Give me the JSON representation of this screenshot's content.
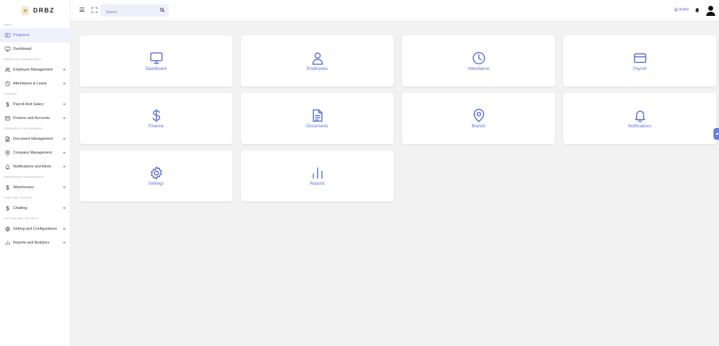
{
  "brand": {
    "name": "DRBZ"
  },
  "header": {
    "search_placeholder": "Search",
    "language": "Arabic"
  },
  "sidebar": {
    "sections": [
      {
        "title": "MAIN",
        "items": [
          {
            "label": "Programs",
            "icon": "grid-icon",
            "active": true,
            "expandable": false
          },
          {
            "label": "Dashboard",
            "icon": "monitor-icon",
            "active": false,
            "expandable": false
          }
        ]
      },
      {
        "title": "EMPLOYEE MANAGEMENT",
        "items": [
          {
            "label": "Employee Management",
            "icon": "users-icon",
            "expandable": true
          },
          {
            "label": "Attendance & Leave",
            "icon": "clock-icon",
            "expandable": true
          }
        ]
      },
      {
        "title": "FINANCE",
        "items": [
          {
            "label": "Payroll And Salary",
            "icon": "dollar-icon",
            "expandable": true
          },
          {
            "label": "Finance and Accounts",
            "icon": "card-icon",
            "expandable": true
          }
        ]
      },
      {
        "title": "DOCUMENTS AND BRANCH",
        "items": [
          {
            "label": "Document Management",
            "icon": "file-icon",
            "expandable": true
          },
          {
            "label": "Company Management",
            "icon": "pin-icon",
            "expandable": true
          },
          {
            "label": "Notifications and Alerts",
            "icon": "bell-icon",
            "expandable": true
          }
        ]
      },
      {
        "title": "WAREHOUSE MANAGEMENT",
        "items": [
          {
            "label": "Warehouses",
            "icon": "dollar-icon",
            "expandable": true
          }
        ]
      },
      {
        "title": "CHATTING SYSTEM",
        "items": [
          {
            "label": "Chatting",
            "icon": "dollar-icon",
            "expandable": true
          }
        ]
      },
      {
        "title": "SETTING AND REPORTS",
        "items": [
          {
            "label": "Setting and Configurations",
            "icon": "gear-icon",
            "expandable": true
          },
          {
            "label": "Reports and Analytics",
            "icon": "bar-chart-icon",
            "expandable": true
          }
        ]
      }
    ],
    "plus": "+"
  },
  "cards": [
    {
      "label": "Dashboard",
      "icon": "monitor-icon"
    },
    {
      "label": "Employees",
      "icon": "user-icon"
    },
    {
      "label": "Attendance",
      "icon": "clock-icon"
    },
    {
      "label": "Payroll",
      "icon": "card-icon"
    },
    {
      "label": "Finance",
      "icon": "dollar-icon"
    },
    {
      "label": "Documents",
      "icon": "file-icon"
    },
    {
      "label": "Branch",
      "icon": "pin-icon"
    },
    {
      "label": "Notifications",
      "icon": "bell-icon"
    },
    {
      "label": "Settings",
      "icon": "gear-icon"
    },
    {
      "label": "Reports",
      "icon": "bar-chart-icon"
    }
  ],
  "colors": {
    "accent": "#5a6fd6",
    "background": "#f2f2f3",
    "active_bg": "#eef0fb"
  }
}
